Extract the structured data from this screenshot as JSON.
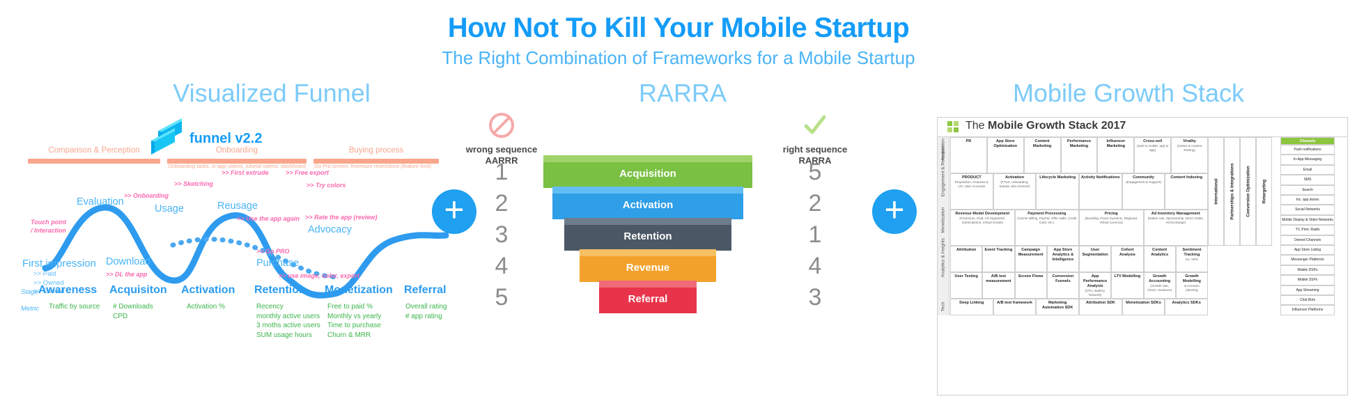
{
  "header": {
    "title": "How Not To Kill Your Mobile Startup",
    "subtitle": "The Right Combination of Frameworks for a Mobile Startup"
  },
  "sections": {
    "funnel_title": "Visualized Funnel",
    "rarra_title": "RARRA",
    "mgs_title": "Mobile Growth Stack"
  },
  "funnel": {
    "logo_name": "funnel v2.2",
    "phases": [
      {
        "label": "Comparison & Perception",
        "sub": ""
      },
      {
        "label": "Onboarding",
        "sub": "Onboarding tasks, in-app videos, tutorial videos, dashboard"
      },
      {
        "label": "Buying process",
        "sub": "Go Pro screen, freemium restrictions (feature limit)"
      }
    ],
    "legend_touchpoint": "Touch point\n/ Interaction",
    "nodes": [
      {
        "name": "Evaluation"
      },
      {
        "name": "First impression"
      },
      {
        "name": "Download"
      },
      {
        "name": "Usage"
      },
      {
        "name": "Reusage"
      },
      {
        "name": "Purchase"
      },
      {
        "name": "Advocacy"
      }
    ],
    "first_impression_subs": [
      ">> Paid",
      ">> Owned",
      ">> Earned"
    ],
    "touchpoints": [
      ">> Onboarding",
      ">> Sketching",
      ">> First extrude",
      ">> Free export",
      ">> Try colors",
      ">> Use the app again",
      ">> DL the app",
      ">> Go PRO",
      ">> use image, color, export",
      ">> Rate the app (review)"
    ],
    "row_labels": {
      "stage": "Stage",
      "metric": "Metric"
    },
    "stages": [
      {
        "stage": "Awareness",
        "metrics": [
          "Traffic by source"
        ]
      },
      {
        "stage": "Acquisiton",
        "metrics": [
          "# Downloads",
          "CPD"
        ]
      },
      {
        "stage": "Activation",
        "metrics": [
          "Activation %"
        ]
      },
      {
        "stage": "Retention",
        "metrics": [
          "Recency",
          "monthly active users",
          "3 moths active users",
          "SUM usage hours"
        ]
      },
      {
        "stage": "Monetization",
        "metrics": [
          "Free to paid %",
          "Monthly vs yearly",
          "Time to purchase",
          "Churn & MRR"
        ]
      },
      {
        "stage": "Referral",
        "metrics": [
          "Overall rating",
          "# app rating"
        ]
      }
    ]
  },
  "rarra": {
    "wrong": {
      "icon": "no-entry-icon",
      "line1": "wrong sequence",
      "line2": "AARRR",
      "numbers": [
        "1",
        "2",
        "3",
        "4",
        "5"
      ]
    },
    "right": {
      "icon": "check-icon",
      "line1": "right sequence",
      "line2": "RARRA",
      "numbers": [
        "5",
        "2",
        "1",
        "4",
        "3"
      ]
    },
    "steps": [
      {
        "label": "Acquisition",
        "color": "#7ac043"
      },
      {
        "label": "Activation",
        "color": "#2f9fe8"
      },
      {
        "label": "Retention",
        "color": "#4c5866"
      },
      {
        "label": "Revenue",
        "color": "#f2a22b"
      },
      {
        "label": "Referral",
        "color": "#e8344a"
      }
    ]
  },
  "plus_symbol": "+",
  "mgs": {
    "title_prefix": "The ",
    "title_main": "Mobile Growth Stack 2017",
    "rows": [
      {
        "side": "Acquisition",
        "cells": [
          {
            "t": "PR",
            "s": ""
          },
          {
            "t": "App Store Optimization",
            "s": ""
          },
          {
            "t": "Content Marketing",
            "s": ""
          },
          {
            "t": "Performance Marketing",
            "s": ""
          },
          {
            "t": "Influencer Marketing",
            "s": ""
          },
          {
            "t": "Cross-sell",
            "s": "(web to mobile, app to app)"
          },
          {
            "t": "Virality",
            "s": "(invites & content sharing)"
          }
        ]
      },
      {
        "side": "Engagement & Retention",
        "cells": [
          {
            "t": "PRODUCT",
            "s": "Proposition, Features & UX, User Accounts"
          },
          {
            "t": "Activation",
            "s": "(FTUX, onboarding, tutorial, aha moment)"
          },
          {
            "t": "Lifecycle Marketing",
            "s": ""
          },
          {
            "t": "Activity Notifications",
            "s": ""
          },
          {
            "t": "Community",
            "s": "(Engagement & Support)"
          },
          {
            "t": "Content Indexing",
            "s": ""
          }
        ]
      },
      {
        "side": "Monetization",
        "cells": [
          {
            "t": "Revenue Model Development",
            "s": "(Freemium, Paid, Ad-Supported, Subscriptions, Virtual Goods)"
          },
          {
            "t": "Payment Processing",
            "s": "(Carrier Billing, PayPal, Offer walls, Credit Card, etc.)"
          },
          {
            "t": "Pricing",
            "s": "(Bundling, Fixed, Dynamic, Regional, Virtual currency)"
          },
          {
            "t": "Ad Inventory Management",
            "s": "(Native Ads, Sponsorship, Direct Sales, Ad Exchange)"
          }
        ]
      },
      {
        "side": "Analytics & Insights",
        "cells": [
          {
            "t": "Attribution",
            "s": ""
          },
          {
            "t": "Event Tracking",
            "s": ""
          },
          {
            "t": "Campaign Measurement",
            "s": ""
          },
          {
            "t": "App Store Analytics & Intelligence",
            "s": ""
          },
          {
            "t": "User Segmentation",
            "s": ""
          },
          {
            "t": "Cohort Analysis",
            "s": ""
          },
          {
            "t": "Content Analytics",
            "s": ""
          },
          {
            "t": "Sentiment Tracking",
            "s": "inc. NPS"
          },
          {
            "t": "User Testing",
            "s": ""
          },
          {
            "t": "A/B test measurement",
            "s": ""
          },
          {
            "t": "Screen Flows",
            "s": ""
          },
          {
            "t": "Conversion Funnels",
            "s": ""
          },
          {
            "t": "App Performance Analysis",
            "s": "(CPU, Battery, Network)"
          },
          {
            "t": "LTV Modelling",
            "s": ""
          },
          {
            "t": "Growth Accounting",
            "s": "(Growth rate, Churn, Sessions)"
          },
          {
            "t": "Growth Modelling",
            "s": "& scenario planning"
          }
        ]
      },
      {
        "side": "Tech",
        "cells": [
          {
            "t": "Deep Linking",
            "s": ""
          },
          {
            "t": "A/B test framework",
            "s": ""
          },
          {
            "t": "Marketing Automation SDK",
            "s": ""
          },
          {
            "t": "Attribution SDK",
            "s": ""
          },
          {
            "t": "Monetization SDKs",
            "s": ""
          },
          {
            "t": "Analytics SDKs",
            "s": ""
          }
        ]
      }
    ],
    "vertical_columns": [
      "International",
      "Partnerships & Integrations",
      "Conversion Optimization",
      "Retargeting"
    ],
    "channels_header": "Channels",
    "channels": [
      "Push notifications",
      "In-App Messaging",
      "Email",
      "SMS",
      "Search",
      "Inc. app stores",
      "Social Networks",
      "Mobile Display & Video Networks",
      "TV, Print, Radio",
      "Owned Channels",
      "App Store Listing",
      "Messenger Platforms",
      "Mobile DSPs",
      "Mobile SSPs",
      "App Streaming",
      "Chat Bots",
      "Influencer Platforms"
    ]
  }
}
